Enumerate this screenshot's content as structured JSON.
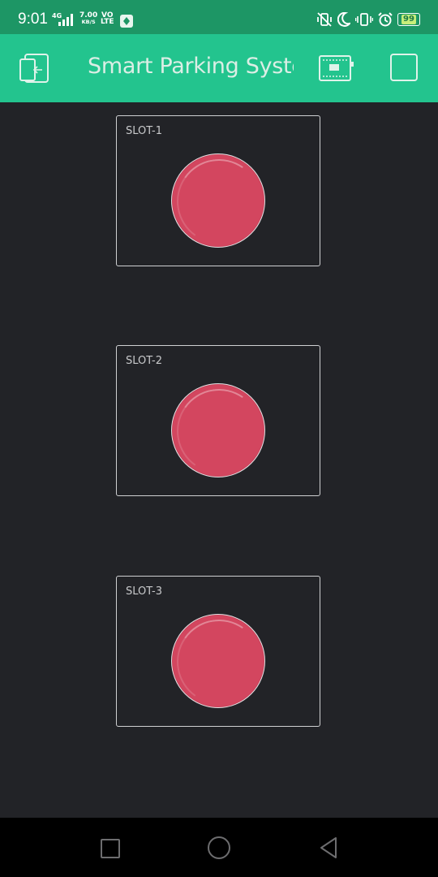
{
  "status_bar": {
    "time": "9:01",
    "network_type": "4G",
    "speed_value": "7.00",
    "speed_unit": "KB/S",
    "volte_top": "VO",
    "volte_bottom": "LTE",
    "battery_level": "99",
    "icons": [
      "signal-icon",
      "app-notification-icon",
      "vibrate-off-icon",
      "moon-icon",
      "vibrate-icon",
      "alarm-icon",
      "battery-icon"
    ],
    "colors": {
      "background": "#1d9665",
      "battery_fill": "#c6ee7a"
    }
  },
  "app_bar": {
    "title": "Smart Parking Syster",
    "icons": [
      "logout-icon",
      "device-board-icon",
      "stop-icon"
    ],
    "background": "#23c48e"
  },
  "slots": [
    {
      "label": "SLOT-1",
      "led_color": "#d3465f"
    },
    {
      "label": "SLOT-2",
      "led_color": "#d3465f"
    },
    {
      "label": "SLOT-3",
      "led_color": "#d3465f"
    }
  ],
  "theme": {
    "background": "#222327"
  },
  "nav_bar": {
    "icons": [
      "recents-icon",
      "home-icon",
      "back-icon"
    ]
  }
}
